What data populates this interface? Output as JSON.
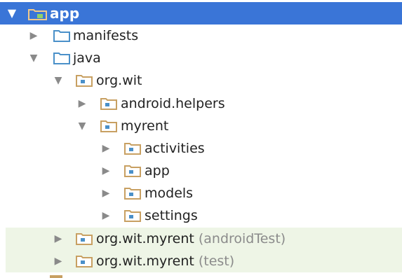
{
  "tree": {
    "nodes": [
      {
        "key": "app",
        "label": "app",
        "expanded": true,
        "selected": true,
        "icon": "module-folder-icon"
      },
      {
        "key": "manifests",
        "label": "manifests",
        "expanded": false,
        "icon": "folder-icon"
      },
      {
        "key": "java",
        "label": "java",
        "expanded": true,
        "icon": "folder-icon"
      },
      {
        "key": "org-wit",
        "label": "org.wit",
        "expanded": true,
        "icon": "package-icon"
      },
      {
        "key": "android-helpers",
        "label": "android.helpers",
        "expanded": false,
        "icon": "package-icon"
      },
      {
        "key": "myrent",
        "label": "myrent",
        "expanded": true,
        "icon": "package-icon"
      },
      {
        "key": "activities",
        "label": "activities",
        "expanded": false,
        "icon": "package-icon"
      },
      {
        "key": "app-sub",
        "label": "app",
        "expanded": false,
        "icon": "package-icon"
      },
      {
        "key": "models",
        "label": "models",
        "expanded": false,
        "icon": "package-icon"
      },
      {
        "key": "settings",
        "label": "settings",
        "expanded": false,
        "icon": "package-icon"
      },
      {
        "key": "org-wit-myrent-androidtest",
        "label": "org.wit.myrent",
        "suffix": "(androidTest)",
        "expanded": false,
        "icon": "package-icon"
      },
      {
        "key": "org-wit-myrent-test",
        "label": "org.wit.myrent",
        "suffix": "(test)",
        "expanded": false,
        "icon": "package-icon"
      }
    ],
    "glyphs": {
      "expanded": "▼",
      "collapsed": "▶"
    }
  },
  "colors": {
    "selection": "#3a75d7",
    "test_row": "#eef5e6",
    "folder": "#4a90c9",
    "package": "#c8a062"
  }
}
